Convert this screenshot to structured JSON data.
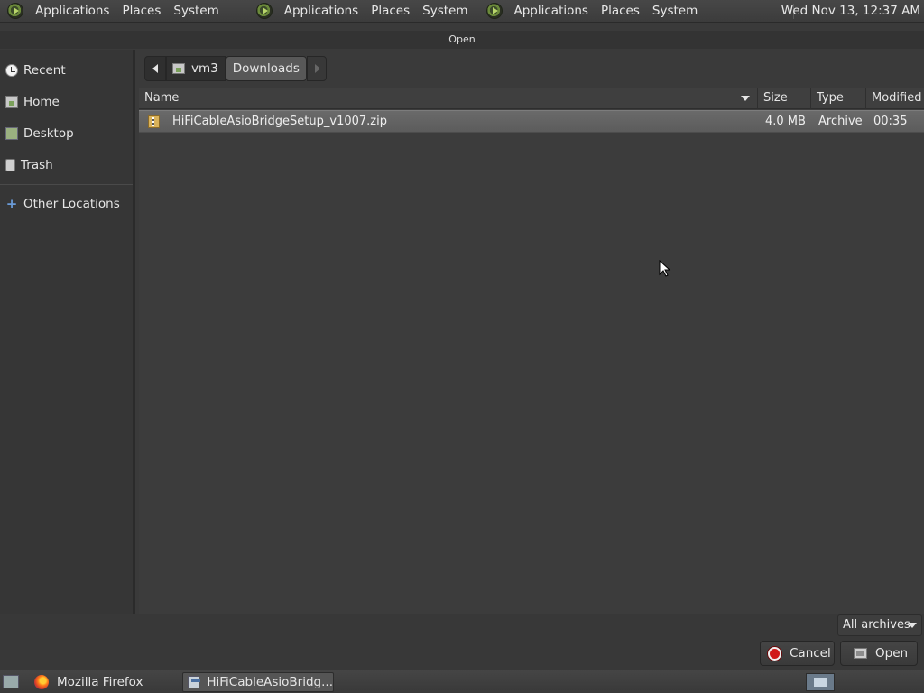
{
  "top_panel": {
    "groups": [
      {
        "items": [
          "Applications",
          "Places",
          "System"
        ]
      },
      {
        "items": [
          "Applications",
          "Places",
          "System"
        ]
      },
      {
        "items": [
          "Applications",
          "Places",
          "System"
        ]
      }
    ],
    "clock": "Wed Nov 13, 12:37 AM"
  },
  "window": {
    "title": "Open"
  },
  "sidebar": {
    "items": [
      {
        "label": "Recent",
        "icon": "clock-icon"
      },
      {
        "label": "Home",
        "icon": "home-folder-icon"
      },
      {
        "label": "Desktop",
        "icon": "desktop-icon"
      },
      {
        "label": "Trash",
        "icon": "trash-icon"
      },
      {
        "label": "Other Locations",
        "icon": "plus-icon"
      }
    ]
  },
  "pathbar": {
    "crumbs": [
      "vm3",
      "Downloads"
    ]
  },
  "file_list": {
    "columns": [
      "Name",
      "Size",
      "Type",
      "Modified"
    ],
    "rows": [
      {
        "name": "HiFiCableAsioBridgeSetup_v1007.zip",
        "size": "4.0 MB",
        "type": "Archive",
        "modified": "00:35"
      }
    ]
  },
  "filter": {
    "selected": "All archives"
  },
  "actions": {
    "cancel_label": "Cancel",
    "open_label": "Open"
  },
  "taskbar": {
    "tasks": [
      {
        "label": "Mozilla Firefox"
      },
      {
        "label": "HiFiCableAsioBridg..."
      }
    ]
  },
  "colors": {
    "accent_cancel": "#d01818",
    "selection_row": "#636363",
    "panel_bg": "#3c3c3c"
  }
}
